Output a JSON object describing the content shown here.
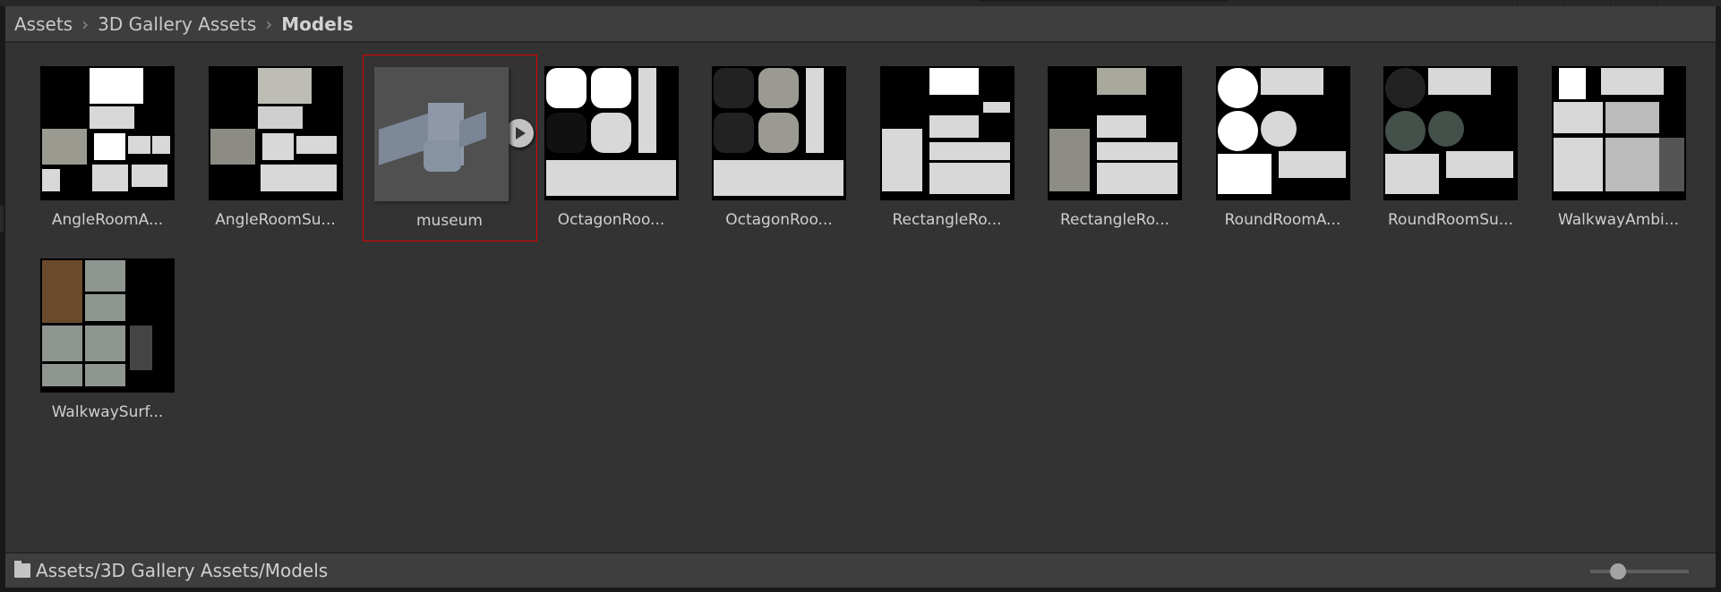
{
  "breadcrumb": [
    "Assets",
    "3D Gallery Assets",
    "Models"
  ],
  "assets": [
    {
      "name": "AngleRoomA...",
      "kind": "texture",
      "style": "angle-amb"
    },
    {
      "name": "AngleRoomSu...",
      "kind": "texture",
      "style": "angle-surf"
    },
    {
      "name": "museum",
      "kind": "model",
      "selected": true
    },
    {
      "name": "OctagonRoo...",
      "kind": "texture",
      "style": "oct-amb"
    },
    {
      "name": "OctagonRoo...",
      "kind": "texture",
      "style": "oct-surf"
    },
    {
      "name": "RectangleRo...",
      "kind": "texture",
      "style": "rect-amb"
    },
    {
      "name": "RectangleRo...",
      "kind": "texture",
      "style": "rect-surf"
    },
    {
      "name": "RoundRoomA...",
      "kind": "texture",
      "style": "round-amb"
    },
    {
      "name": "RoundRoomSu...",
      "kind": "texture",
      "style": "round-surf"
    },
    {
      "name": "WalkwayAmbi...",
      "kind": "texture",
      "style": "walk-amb"
    },
    {
      "name": "WalkwaySurf...",
      "kind": "texture",
      "style": "walk-surf"
    }
  ],
  "footer": {
    "path": "Assets/3D Gallery Assets/Models",
    "icon": "folder-icon"
  },
  "colors": {
    "selection": "#e00000",
    "panel": "#333333",
    "bar": "#3e3e3e"
  }
}
